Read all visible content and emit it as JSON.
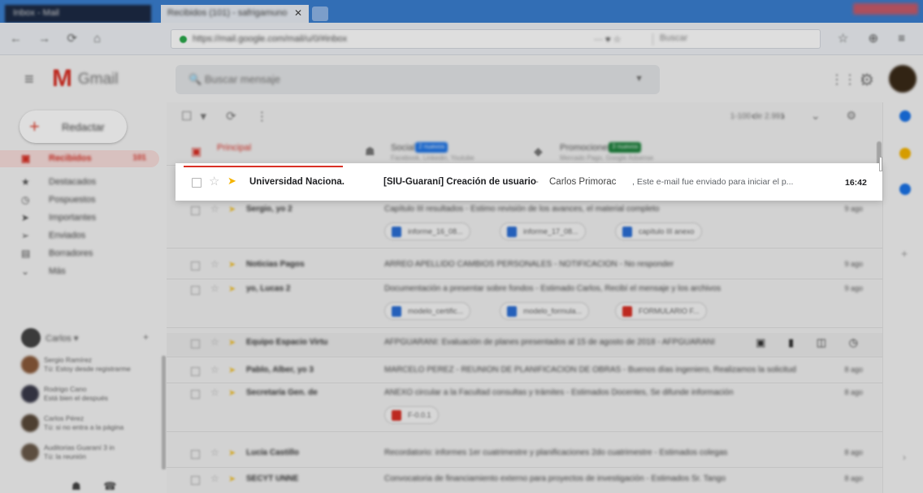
{
  "browser": {
    "tab_left_title": "Inbox - Mail",
    "tab_active_title": "Recibidos (101) - safrigamuno",
    "tab_close": "✕",
    "url": "https://mail.google.com/mail/u/0/#inbox",
    "url_search_placeholder": "Buscar",
    "nav_icons": "← → ⟳ ⌂",
    "nav_right_icons": "☆ ⊕ ≡"
  },
  "gmail_header": {
    "menu_icon": "≡",
    "logo_letter": "M",
    "logo_text": "Gmail",
    "search_placeholder": "Buscar mensaje",
    "search_dropdown": "▼",
    "apps_icon": "⋮⋮⋮",
    "settings_icon": "⚙"
  },
  "sidebar": {
    "compose_icon": "+",
    "compose_label": "Redactar",
    "items": [
      {
        "icon": "▣",
        "label": "Recibidos",
        "count": "101"
      },
      {
        "icon": "★",
        "label": "Destacados",
        "count": ""
      },
      {
        "icon": "◷",
        "label": "Pospuestos",
        "count": ""
      },
      {
        "icon": "➤",
        "label": "Importantes",
        "count": ""
      },
      {
        "icon": "➢",
        "label": "Enviados",
        "count": ""
      },
      {
        "icon": "▤",
        "label": "Borradores",
        "count": ""
      },
      {
        "icon": "⌄",
        "label": "Más",
        "count": ""
      }
    ],
    "hangouts_user": "Carlos",
    "hangouts_user_caret": "▾",
    "hangouts_add": "+",
    "contacts": [
      {
        "name": "Sergio Ramírez",
        "status": "Tú: Estoy desde registrarme",
        "color": "#8a5a3a"
      },
      {
        "name": "Rodrigo Cano",
        "status": "Está bien el después",
        "color": "#3a3a4a"
      },
      {
        "name": "Carlos Pérez",
        "status": "Tú: si no entra a la página",
        "color": "#5a4a3a"
      },
      {
        "name": "Auditorias Guaraní 3 in",
        "status": "Tú: la reunión",
        "color": "#6a5a4a"
      }
    ],
    "bottom_icons": "☗ ☎"
  },
  "toolbar": {
    "icons": "☐▾ ⟳ ⋮",
    "range": "1-100 de 2.991",
    "nav": "‹ › ⌄ ⚙"
  },
  "tabs": [
    {
      "icon": "▣",
      "label": "Principal",
      "sub": "",
      "badge": "",
      "badge_color": ""
    },
    {
      "icon": "☗",
      "label": "Social",
      "sub": "Facebook, Linkedin, Youtube",
      "badge": "2 nuevos",
      "badge_color": "#1a73e8"
    },
    {
      "icon": "◆",
      "label": "Promociones",
      "sub": "Mercado Pago, Google Adsense",
      "badge": "3 nuevos",
      "badge_color": "#188038"
    }
  ],
  "highlighted_email": {
    "sender": "Universidad Naciona.",
    "subject": "[SIU-Guaraní] Creación de usuario",
    "separator": "-",
    "from_name": "Carlos Primorac",
    "snippet": ", Este e-mail fue enviado para iniciar el p...",
    "time": "16:42",
    "star_icon": "☆",
    "important_icon": "➤"
  },
  "emails": [
    {
      "sender": "Sergio, yo 2",
      "subject": "Capítulo III resultados - Estimo revisión de los avances, el material completo",
      "time": "9 ago",
      "chips": [
        {
          "label": "informe_16_08...",
          "color": "#2b6fd6"
        },
        {
          "label": "informe_17_08...",
          "color": "#2b6fd6"
        },
        {
          "label": "capítulo III anexo",
          "color": "#2b6fd6"
        }
      ]
    },
    {
      "sender": "Noticias Pagos",
      "subject": "ARREO APELLIDO CAMBIOS PERSONALES - NOTIFICACIÓN - No responder",
      "time": "9 ago",
      "chips": []
    },
    {
      "sender": "yo, Lucas 2",
      "subject": "Documentación a presentar sobre fondos - Estimado Carlos, Recibí el mensaje y los archivos",
      "time": "9 ago",
      "chips": [
        {
          "label": "modelo_certific...",
          "color": "#2b6fd6"
        },
        {
          "label": "modelo_formula...",
          "color": "#2b6fd6"
        },
        {
          "label": "FORMULARIO F...",
          "color": "#d93025"
        }
      ]
    },
    {
      "sender": "Equipo Espacio Virtu",
      "subject": "AFPGUARANI: Evaluación de planes presentados al 15 de agosto de 2018 - AFPGUARANI",
      "time": "",
      "chips": []
    },
    {
      "sender": "Pablo, Alber, yo 3",
      "subject": "MARCELO PEREZ - REUNIÓN DE PLANIFICACIÓN DE OBRAS - Buenos días ingeniero, Realizamos la solicitud",
      "time": "8 ago",
      "chips": []
    },
    {
      "sender": "Secretaría Gen. de",
      "subject": "ANEXO circular a la Facultad consultas y trámites - Estimados Docentes, Se difunde información",
      "time": "8 ago",
      "chips": [
        {
          "label": "F-0.0.1",
          "color": "#d93025"
        }
      ]
    },
    {
      "sender": "Lucía Castillo",
      "subject": "Recordatorio: informes 1er cuatrimestre y planificaciones 2do cuatrimestre - Estimados colegas",
      "time": "8 ago",
      "chips": []
    },
    {
      "sender": "SECYT UNNE",
      "subject": "Convocatoria de financiamiento externo para proyectos de investigación - Estimados Sr. Tango",
      "time": "8 ago",
      "chips": []
    }
  ],
  "colors": {
    "accent_red": "#d93025",
    "important_yellow": "#f5b400",
    "browser_blue": "#3a7fd0"
  }
}
